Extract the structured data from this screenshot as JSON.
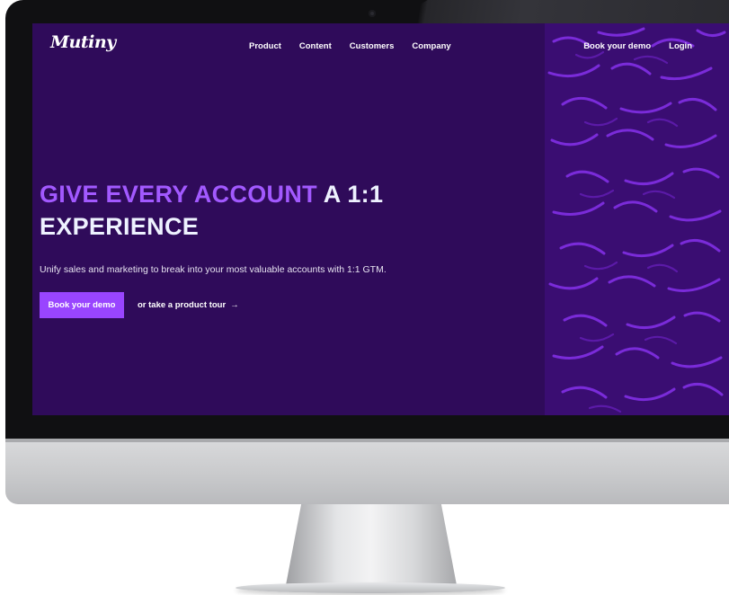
{
  "logo": "Mutiny",
  "nav": {
    "items": [
      "Product",
      "Content",
      "Customers",
      "Company"
    ],
    "book_demo": "Book your demo",
    "login": "Login"
  },
  "hero": {
    "title_accent": "GIVE EVERY ACCOUNT",
    "title_light": "A 1:1",
    "title_line2": "EXPERIENCE",
    "subtitle": "Unify sales and marketing to break into your most valuable accounts with 1:1 GTM.",
    "cta_label": "Book your demo",
    "tour_label": "or take a product tour",
    "tour_arrow": "→"
  },
  "colors": {
    "background": "#2f0b5a",
    "accent": "#a259ff",
    "button": "#9945ff",
    "pattern": "#3a0d72",
    "pattern_stroke": "#7a2bd9"
  },
  "icons": [
    "arrow-right-icon",
    "camera-icon"
  ]
}
